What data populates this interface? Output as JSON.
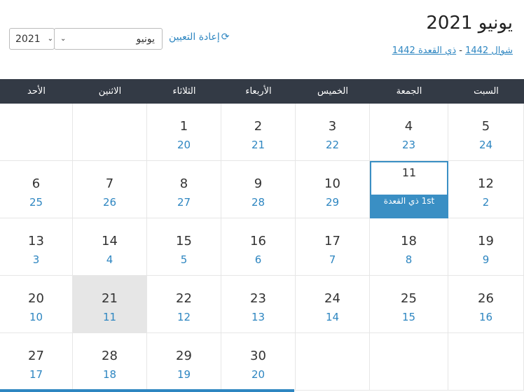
{
  "header": {
    "title": "يونيو 2021",
    "hijri_range_start": "شوال 1442",
    "hijri_range_sep": " - ",
    "hijri_range_end": "ذي القعدة 1442"
  },
  "controls": {
    "reset_label": "إعادة التعيين",
    "reset_icon": "refresh-icon",
    "year_value": "2021",
    "month_value": "يونيو"
  },
  "weekdays": [
    "السبت",
    "الجمعة",
    "الخميس",
    "الأربعاء",
    "الثلاثاء",
    "الاثنين",
    "الأحد"
  ],
  "weeks": [
    [
      {
        "g": "5",
        "h": "24"
      },
      {
        "g": "4",
        "h": "23"
      },
      {
        "g": "3",
        "h": "22"
      },
      {
        "g": "2",
        "h": "21"
      },
      {
        "g": "1",
        "h": "20"
      },
      {
        "g": "",
        "h": ""
      },
      {
        "g": "",
        "h": ""
      }
    ],
    [
      {
        "g": "12",
        "h": "2"
      },
      {
        "g": "11",
        "h": "",
        "selected": true,
        "band": "1st ذي القعدة"
      },
      {
        "g": "10",
        "h": "29"
      },
      {
        "g": "9",
        "h": "28"
      },
      {
        "g": "8",
        "h": "27"
      },
      {
        "g": "7",
        "h": "26"
      },
      {
        "g": "6",
        "h": "25"
      }
    ],
    [
      {
        "g": "19",
        "h": "9"
      },
      {
        "g": "18",
        "h": "8"
      },
      {
        "g": "17",
        "h": "7"
      },
      {
        "g": "16",
        "h": "6"
      },
      {
        "g": "15",
        "h": "5"
      },
      {
        "g": "14",
        "h": "4"
      },
      {
        "g": "13",
        "h": "3"
      }
    ],
    [
      {
        "g": "26",
        "h": "16"
      },
      {
        "g": "25",
        "h": "15"
      },
      {
        "g": "24",
        "h": "14"
      },
      {
        "g": "23",
        "h": "13"
      },
      {
        "g": "22",
        "h": "12"
      },
      {
        "g": "21",
        "h": "11",
        "today": true
      },
      {
        "g": "20",
        "h": "10"
      }
    ],
    [
      {
        "g": "",
        "h": ""
      },
      {
        "g": "",
        "h": ""
      },
      {
        "g": "",
        "h": ""
      },
      {
        "g": "30",
        "h": "20"
      },
      {
        "g": "29",
        "h": "19"
      },
      {
        "g": "28",
        "h": "18"
      },
      {
        "g": "27",
        "h": "17"
      }
    ]
  ],
  "colors": {
    "header_bg": "#333a45",
    "accent": "#2e86c1",
    "today_bg": "#e6e6e6"
  }
}
